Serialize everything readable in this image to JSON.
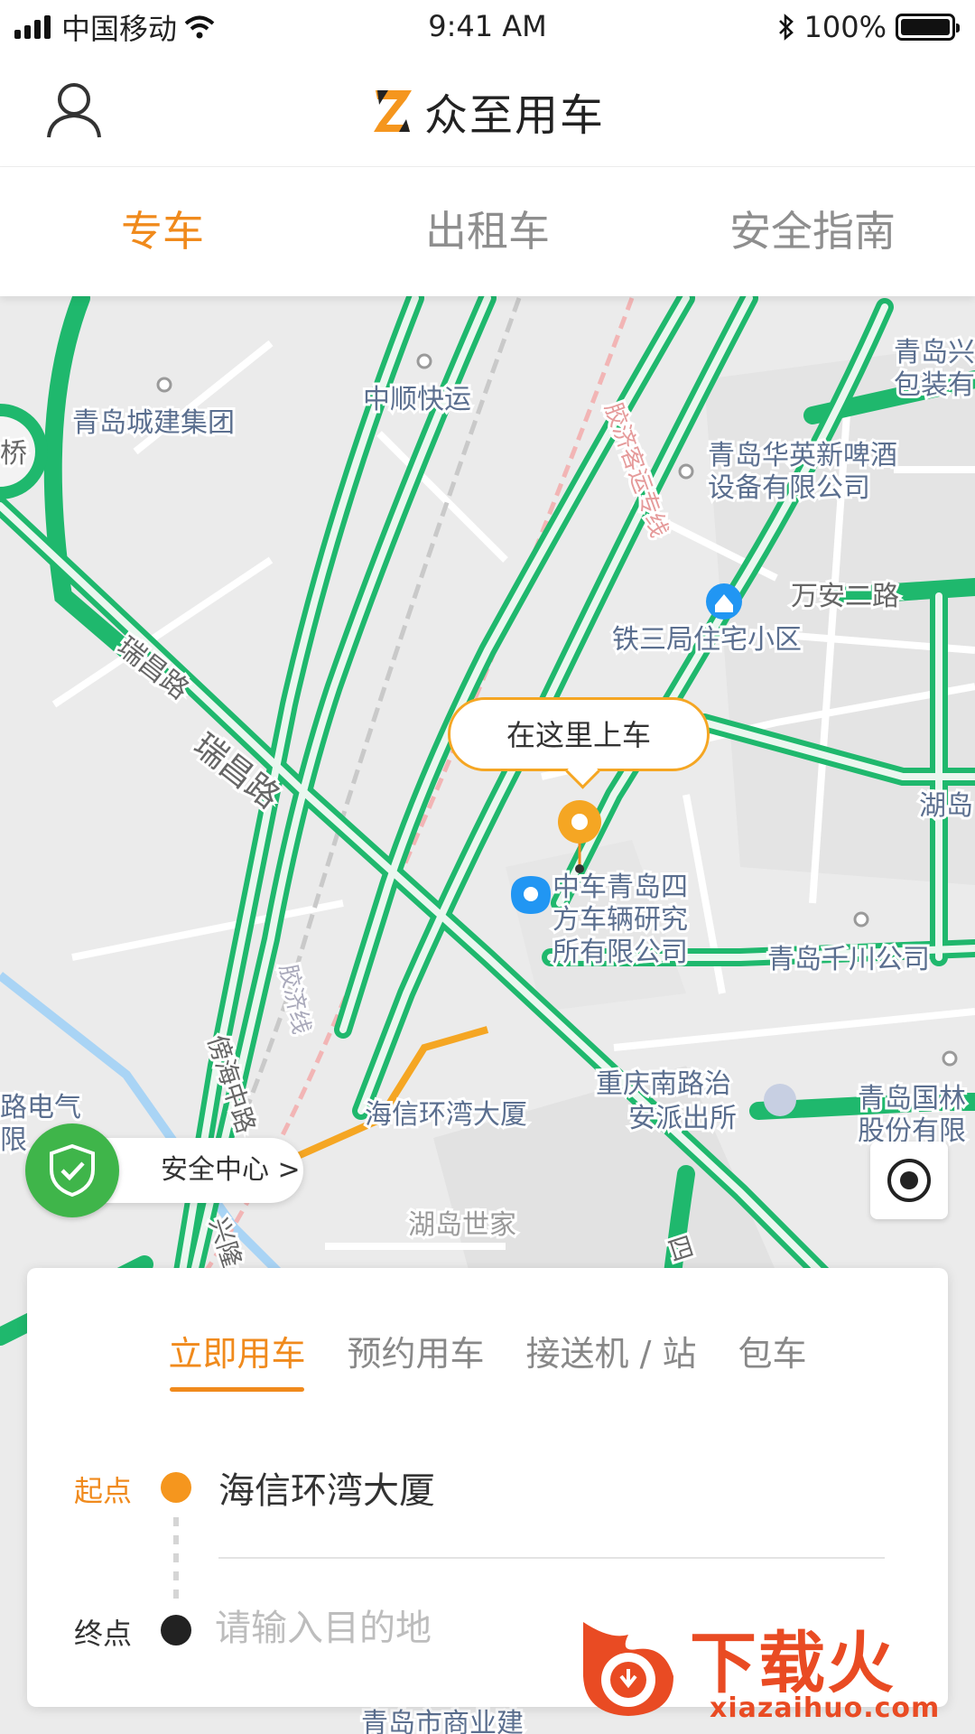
{
  "status_bar": {
    "carrier": "中国移动",
    "time": "9:41 AM",
    "battery": "100%",
    "battery_level": 1.0
  },
  "header": {
    "title": "众至用车",
    "logo_letter": "Z"
  },
  "top_tabs": [
    {
      "label": "专车",
      "active": true
    },
    {
      "label": "出租车",
      "active": false
    },
    {
      "label": "安全指南",
      "active": false
    }
  ],
  "map": {
    "pickup_bubble": "在这里上车",
    "labels": [
      "青岛城建集团",
      "中顺快运",
      "青岛华英新啤酒",
      "设备有限公司",
      "万安二路",
      "铁三局住宅小区",
      "瑞昌路",
      "瑞昌路",
      "中车青岛四",
      "方车辆研究",
      "所有限公司",
      "青岛千川公司",
      "重庆南路治",
      "安派出所",
      "海信环湾大厦",
      "湖岛世家",
      "青岛兴",
      "包装有",
      "胶济客运专线",
      "胶济线",
      "傍海中路",
      "湖岛",
      "路电气",
      "限",
      "青岛国林",
      "股份有限",
      "四",
      "兴隆",
      "青岛市商业建",
      "桥"
    ]
  },
  "safety_center": {
    "label": "安全中心 >"
  },
  "panel": {
    "tabs": [
      {
        "label": "立即用车",
        "active": true
      },
      {
        "label": "预约用车",
        "active": false
      },
      {
        "label": "接送机 / 站",
        "active": false
      },
      {
        "label": "包车",
        "active": false
      }
    ],
    "start_label": "起点",
    "start_value": "海信环湾大厦",
    "end_label": "终点",
    "end_placeholder": "请输入目的地"
  },
  "watermark": {
    "title": "下载火",
    "url": "xiazaihuo.com"
  },
  "colors": {
    "accent": "#f08a1c",
    "road": "#1fb86d",
    "safety": "#3fb54a",
    "brand_red": "#e94b23"
  }
}
